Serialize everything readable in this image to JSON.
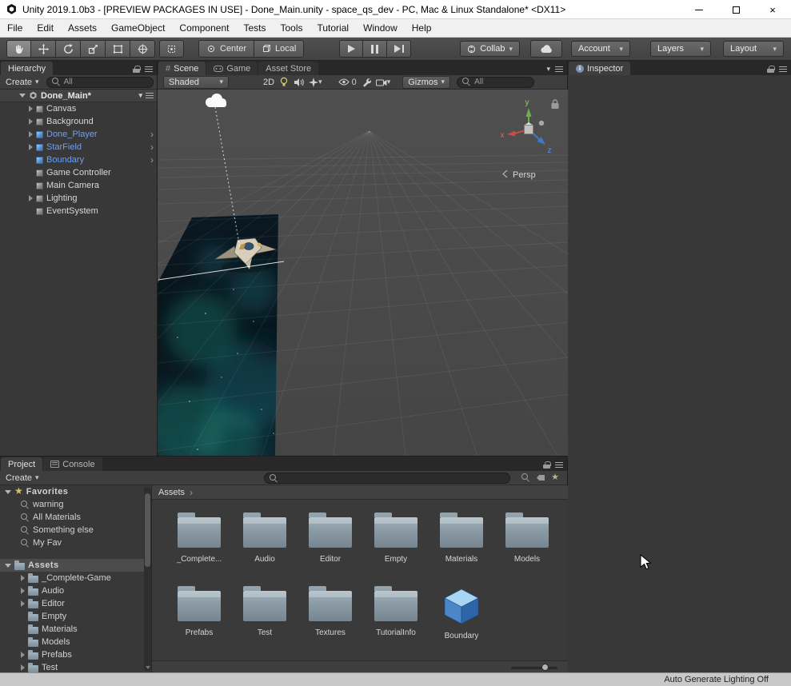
{
  "window": {
    "title": "Unity 2019.1.0b3 - [PREVIEW PACKAGES IN USE] - Done_Main.unity - space_qs_dev - PC, Mac & Linux Standalone* <DX11>"
  },
  "menubar": {
    "items": [
      {
        "label": "File"
      },
      {
        "label": "Edit"
      },
      {
        "label": "Assets"
      },
      {
        "label": "GameObject"
      },
      {
        "label": "Component"
      },
      {
        "label": "Tests"
      },
      {
        "label": "Tools"
      },
      {
        "label": "Tutorial"
      },
      {
        "label": "Window"
      },
      {
        "label": "Help"
      }
    ]
  },
  "toolbar": {
    "pivot_label": "Center",
    "rotation_label": "Local",
    "collab_label": "Collab",
    "account_label": "Account",
    "layers_label": "Layers",
    "layout_label": "Layout"
  },
  "hierarchy": {
    "tab_label": "Hierarchy",
    "create_label": "Create",
    "search_text": "All",
    "scene_name": "Done_Main*",
    "items": [
      {
        "name": "Canvas"
      },
      {
        "name": "Background"
      },
      {
        "name": "Done_Player"
      },
      {
        "name": "StarField"
      },
      {
        "name": "Boundary"
      },
      {
        "name": "Game Controller"
      },
      {
        "name": "Main Camera"
      },
      {
        "name": "Lighting"
      },
      {
        "name": "EventSystem"
      }
    ]
  },
  "scene_view": {
    "tab_scene": "Scene",
    "tab_game": "Game",
    "tab_asset_store": "Asset Store",
    "shading_mode": "Shaded",
    "mode_2d": "2D",
    "hidden_count": "0",
    "gizmos_label": "Gizmos",
    "search_text": "All",
    "axis_x": "x",
    "axis_y": "y",
    "axis_z": "z",
    "projection": "Persp"
  },
  "inspector": {
    "tab_label": "Inspector"
  },
  "project": {
    "tab_project": "Project",
    "tab_console": "Console",
    "create_label": "Create",
    "favorites_label": "Favorites",
    "favorites": [
      {
        "name": "warning"
      },
      {
        "name": "All Materials"
      },
      {
        "name": "Something else"
      },
      {
        "name": "My Fav"
      }
    ],
    "assets_root_label": "Assets",
    "tree": [
      {
        "name": "_Complete-Game"
      },
      {
        "name": "Audio"
      },
      {
        "name": "Editor"
      },
      {
        "name": "Empty"
      },
      {
        "name": "Materials"
      },
      {
        "name": "Models"
      },
      {
        "name": "Prefabs"
      },
      {
        "name": "Test"
      }
    ],
    "breadcrumb": "Assets",
    "items": [
      {
        "name": "_Complete...",
        "type": "folder"
      },
      {
        "name": "Audio",
        "type": "folder"
      },
      {
        "name": "Editor",
        "type": "folder"
      },
      {
        "name": "Empty",
        "type": "folder"
      },
      {
        "name": "Materials",
        "type": "folder"
      },
      {
        "name": "Models",
        "type": "folder"
      },
      {
        "name": "Prefabs",
        "type": "folder"
      },
      {
        "name": "Test",
        "type": "folder"
      },
      {
        "name": "Textures",
        "type": "folder"
      },
      {
        "name": "TutorialInfo",
        "type": "folder"
      },
      {
        "name": "Boundary",
        "type": "prefab"
      }
    ]
  },
  "statusbar": {
    "auto_generate_lighting": "Auto Generate Lighting Off"
  },
  "icons": {
    "caret": "▾",
    "scene_tab_glyph": "#",
    "favorites_star": "★",
    "prefab_open_arrow": "›",
    "breadcrumb_arrow": "›"
  },
  "colors": {
    "prefab_text": "#6f9ff1",
    "selection": "#4c4c4c",
    "folder": "#8fa0aa"
  }
}
